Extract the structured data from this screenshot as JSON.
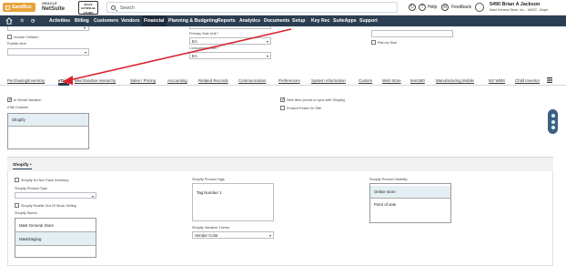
{
  "topbar": {
    "sandbox_label": "SandBox",
    "oracle_line1": "ORACLE",
    "oracle_line2": "NetSuite",
    "mast_line1": "MAST",
    "mast_line2": "GENERAL",
    "mast_line3": "STORE",
    "search_placeholder": "Search",
    "help_label": "Help",
    "feedback_label": "Feedback",
    "user_name": "5490 Brian A Jackson",
    "user_sub": "Mast General Store, Inc. - MAST - Buyer"
  },
  "nav": {
    "items": [
      "Activities",
      "Billing",
      "Customers",
      "Vendors",
      "Financial",
      "Planning & Budgeting",
      "Reports",
      "Analytics",
      "Documents",
      "Setup",
      "Key Rec",
      "SuiteApps",
      "Support"
    ],
    "active": "Financial"
  },
  "form_top": {
    "include_children_label": "Include Children",
    "publish_item_label": "Publish Item",
    "primary_sale_unit_label": "Primary Sale Unit",
    "primary_sale_unit_value": "EA",
    "consumption_unit_label": "Consumption Unit",
    "consumption_unit_value": "EA",
    "third_unit_value": "EA",
    "plan_by_size_label": "Plan by Size"
  },
  "tabs": [
    "Purchasing/Inventory",
    "eTail",
    "Merchandise Hierarchy",
    "Sales / Pricing",
    "Accounting",
    "Related Records",
    "Communication",
    "Preferences",
    "System Information",
    "Custom",
    "Web Store",
    "Item360",
    "Manufacturing Mobile",
    "NS WMS",
    "Child Inventor"
  ],
  "active_tab": "eTail",
  "etail": {
    "is_virtual_variation_label": "Is Virtual Variation",
    "is_virtual_variation_checked": true,
    "etail_channel_label": "eTail Channel",
    "etail_channel_options": [
      "Shopify"
    ],
    "web_item_label": "Web Item (check to sync with Shopify)",
    "web_item_checked": true,
    "product_exists_label": "Product Exists On Site",
    "product_exists_checked": false
  },
  "subtab": {
    "label": "Shopify •"
  },
  "shopify": {
    "do_not_track_label": "Shopify Do Not Track Inventory",
    "product_type_label": "Shopify Product Type",
    "enable_oos_label": "Shopify Enable Out Of Stock Selling",
    "stores_label": "Shopify Stores",
    "stores": [
      "Mast General Store",
      "MastStaging"
    ],
    "product_tags_label": "Shopify Product Tags",
    "product_tags_value": "Tag Number 1",
    "variation_theme_label": "Shopify Variation Theme",
    "variation_theme_value": "Vendor Color",
    "visibility_label": "Shopify Product Visibility",
    "visibility_options": [
      "Online store",
      "Point of sale"
    ]
  }
}
